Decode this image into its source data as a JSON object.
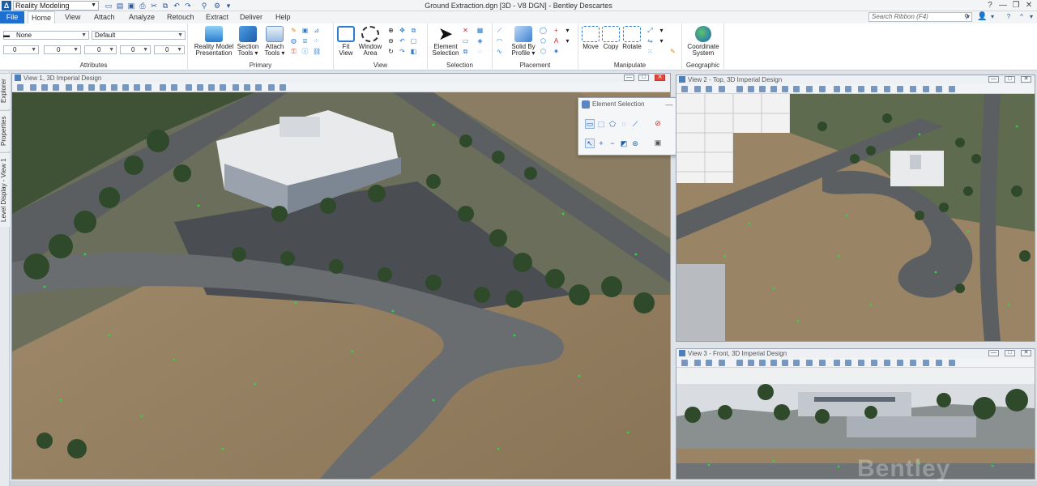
{
  "titlebar": {
    "workflow": "Reality Modeling",
    "window_title": "Ground Extraction.dgn [3D - V8 DGN] - Bentley Descartes",
    "controls": [
      "?",
      "—",
      "❐",
      "✕"
    ]
  },
  "tabs": [
    "File",
    "Home",
    "View",
    "Attach",
    "Analyze",
    "Retouch",
    "Extract",
    "Deliver",
    "Help"
  ],
  "active_tab": "Home",
  "search": {
    "placeholder": "Search Ribbon (F4)"
  },
  "ribbon": {
    "attributes": {
      "label": "Attributes",
      "level": "None",
      "style": "Default",
      "color": "0",
      "weight": "0",
      "linestyle": "0",
      "transparency": "0",
      "priority": "0"
    },
    "primary": {
      "label": "Primary",
      "buttons": [
        {
          "line1": "Reality Model",
          "line2": "Presentation"
        },
        {
          "line1": "Section",
          "line2": "Tools ▾"
        },
        {
          "line1": "Attach",
          "line2": "Tools ▾"
        }
      ]
    },
    "view": {
      "label": "View",
      "buttons": [
        {
          "line1": "Fit",
          "line2": "View"
        },
        {
          "line1": "Window",
          "line2": "Area"
        }
      ]
    },
    "selection": {
      "label": "Selection",
      "buttons": [
        {
          "line1": "Element",
          "line2": "Selection"
        }
      ]
    },
    "placement": {
      "label": "Placement",
      "buttons": [
        {
          "line1": "Solid By",
          "line2": "Profile ▾"
        }
      ]
    },
    "manipulate": {
      "label": "Manipulate",
      "buttons": [
        "Move",
        "Copy",
        "Rotate"
      ]
    },
    "geographic": {
      "label": "Geographic",
      "buttons": [
        {
          "line1": "Coordinate",
          "line2": "System"
        }
      ]
    }
  },
  "left_panel": [
    "Explorer",
    "Properties",
    "Level Display - View 1"
  ],
  "views": {
    "view1": {
      "title": "View 1, 3D Imperial Design"
    },
    "view2": {
      "title": "View 2 - Top, 3D Imperial Design"
    },
    "view3": {
      "title": "View 3 - Front, 3D Imperial Design"
    }
  },
  "element_selection": {
    "title": "Element Selection"
  },
  "watermark": "Bentley",
  "colors": {
    "accent": "#1d6fd1",
    "terrain": "#9a8466",
    "road": "#5c5f62",
    "trees": "#2f4a2a",
    "points": "#22e03a"
  }
}
